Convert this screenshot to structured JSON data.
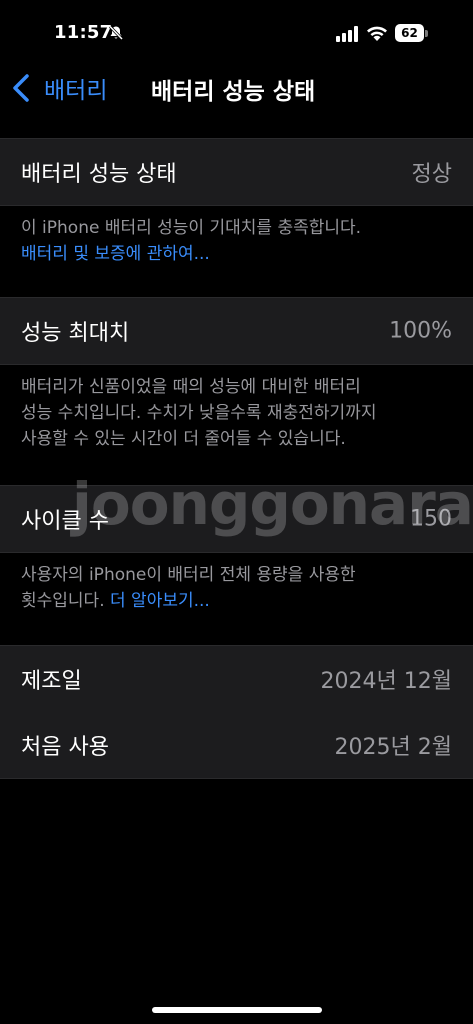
{
  "status_bar": {
    "time": "11:57",
    "battery_level": "62",
    "icons": [
      "bell-slash-icon",
      "cellular-signal-icon",
      "wifi-icon",
      "battery-icon"
    ]
  },
  "nav": {
    "back_label": "배터리",
    "title": "배터리 성능 상태"
  },
  "sections": {
    "health": {
      "label": "배터리 성능 상태",
      "value": "정상",
      "footer_text": "이 iPhone 배터리 성능이 기대치를 충족합니다.",
      "footer_link": "배터리 및 보증에 관하여..."
    },
    "max_capacity": {
      "label": "성능 최대치",
      "value": "100%",
      "footer_line1": "배터리가 신품이었을 때의 성능에 대비한 배터리",
      "footer_line2": "성능 수치입니다. 수치가 낮을수록 재충전하기까지",
      "footer_line3": "사용할 수 있는 시간이 더 줄어들 수 있습니다."
    },
    "cycle_count": {
      "label": "사이클 수",
      "value": "150",
      "footer_line1": "사용자의 iPhone이 배터리 전체 용량을 사용한",
      "footer_text2": "횟수입니다.",
      "footer_link": "더 알아보기..."
    },
    "dates": {
      "manufactured_label": "제조일",
      "manufactured_value": "2024년 12월",
      "first_use_label": "처음 사용",
      "first_use_value": "2025년 2월"
    }
  },
  "watermark": "joonggonara",
  "colors": {
    "accent": "#3a8dfb",
    "background": "#000000",
    "group_background": "#1c1c1e",
    "secondary_text": "#98989d"
  }
}
